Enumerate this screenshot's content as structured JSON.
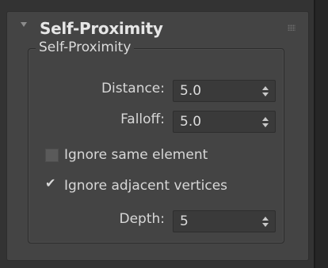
{
  "rollout": {
    "title": "Self-Proximity",
    "icons": {
      "collapse": "triangle-down-icon",
      "grip": "drag-grip-icon"
    }
  },
  "group": {
    "legend": "Self-Proximity"
  },
  "fields": {
    "distance": {
      "label": "Distance:",
      "value": "5.0"
    },
    "falloff": {
      "label": "Falloff:",
      "value": "5.0"
    },
    "depth": {
      "label": "Depth:",
      "value": "5"
    }
  },
  "checkboxes": {
    "ignore_same_element": {
      "label": "Ignore same element",
      "checked": false
    },
    "ignore_adjacent_vertices": {
      "label": "Ignore adjacent vertices",
      "checked": true,
      "mark": "✔"
    }
  },
  "colors": {
    "panel_bg": "#444444",
    "window_bg": "#333333",
    "text": "#d8d8d8",
    "title_text": "#e6e6e6"
  }
}
